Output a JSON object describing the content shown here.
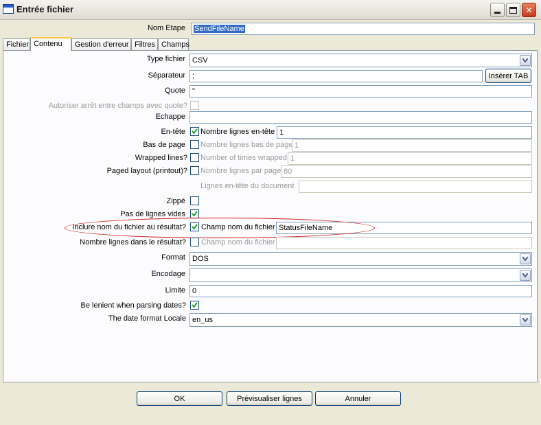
{
  "window": {
    "title": "Entrée fichier"
  },
  "step_name": {
    "label": "Nom Etape",
    "value": "SendFileName"
  },
  "tabs": [
    {
      "label": "Fichier"
    },
    {
      "label": "Contenu"
    },
    {
      "label": "Gestion d'erreur"
    },
    {
      "label": "Filtres"
    },
    {
      "label": "Champs"
    }
  ],
  "active_tab": "Contenu",
  "content": {
    "file_type": {
      "label": "Type fichier",
      "value": "CSV"
    },
    "separator": {
      "label": "Séparateur",
      "value": ";",
      "insert_tab_button": "Insérer TAB"
    },
    "quote": {
      "label": "Quote",
      "value": "\""
    },
    "allow_breaks": {
      "label": "Autoriser arrêt entre champs avec quote?"
    },
    "escape": {
      "label": "Echappe",
      "value": ""
    },
    "header": {
      "label": "En-tête",
      "checked": true,
      "sub_label": "Nombre lignes en-tête",
      "value": "1"
    },
    "footer": {
      "label": "Bas de page",
      "checked": false,
      "sub_label": "Nombre lignes bas de page",
      "value": "1"
    },
    "wrapped": {
      "label": "Wrapped lines?",
      "checked": false,
      "sub_label": "Number of times wrapped",
      "value": "1"
    },
    "paged": {
      "label": "Paged layout (printout)?",
      "checked": false,
      "sub_label": "Nombre lignes par page",
      "value": "80"
    },
    "doc_header": {
      "sub_label": "Lignes en-tête du document",
      "value": ""
    },
    "zipped": {
      "label": "Zippé",
      "checked": false
    },
    "no_empty_rows": {
      "label": "Pas de lignes vides",
      "checked": true
    },
    "include_filename": {
      "label": "Inclure nom du fichier au résultat?",
      "checked": true,
      "sub_label": "Champ nom du fichier",
      "value": "StatusFileName"
    },
    "row_number": {
      "label": "Nombre lignes dans le résultat?",
      "checked": false,
      "sub_label": "Champ nom du fichier",
      "value": ""
    },
    "format": {
      "label": "Format",
      "value": "DOS"
    },
    "encoding": {
      "label": "Encodage",
      "value": ""
    },
    "limit": {
      "label": "Limite",
      "value": "0"
    },
    "lenient_dates": {
      "label": "Be lenient when parsing dates?",
      "checked": true
    },
    "date_locale": {
      "label": "The date format Locale",
      "value": "en_us"
    }
  },
  "buttons": {
    "ok": "OK",
    "preview": "Prévisualiser lignes",
    "cancel": "Annuler"
  },
  "colors": {
    "dialog_bg": "#ece9d8",
    "panel_bg": "#fcfcfe",
    "input_border": "#7f9db9",
    "highlight_ellipse": "#d01818",
    "selection": "#316ac5"
  }
}
